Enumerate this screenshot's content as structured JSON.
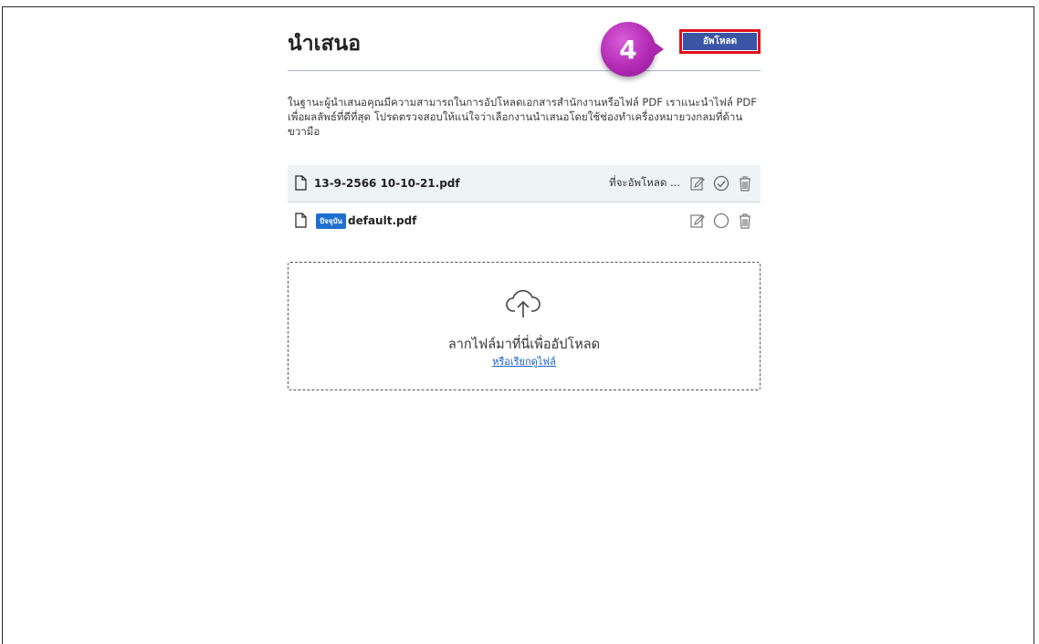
{
  "page": {
    "title": "นำเสนอ",
    "step_number": "4",
    "upload_button_label": "อัพโหลด",
    "description": "ในฐานะผู้นำเสนอคุณมีความสามารถในการอัปโหลดเอกสารสำนักงานหรือไฟล์ PDF เราแนะนำไฟล์ PDF เพื่อผลลัพธ์ที่ดีที่สุด โปรดตรวจสอบให้แน่ใจว่าเลือกงานนำเสนอโดยใช้ช่องทำเครื่องหมายวงกลมที่ด้านขวามือ"
  },
  "files": [
    {
      "name": "13-9-2566 10-10-21.pdf",
      "status": "ที่จะอัพโหลด ...",
      "selected": true
    },
    {
      "name": "default.pdf",
      "badge": "ปัจจุบัน",
      "selected": false
    }
  ],
  "dropzone": {
    "text": "ลากไฟล์มาที่นี่เพื่ออัปโหลด",
    "link": "หรือเรียกดูไฟล์"
  },
  "colors": {
    "accent": "#3a55a4",
    "highlight_border": "#e0111a",
    "step_badge": "#b22ab4",
    "current_badge": "#1f6fcf",
    "link": "#1a5dc8"
  }
}
